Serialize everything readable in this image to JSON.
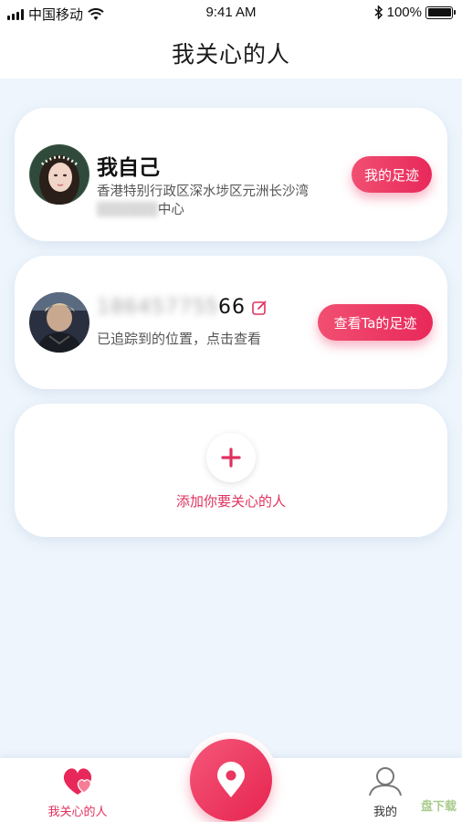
{
  "status_bar": {
    "carrier": "中国移动",
    "time": "9:41 AM",
    "battery": "100%",
    "battery_level": 1.0
  },
  "nav": {
    "title": "我关心的人"
  },
  "cards": {
    "self": {
      "name": "我自己",
      "address": "香港特别行政区深水埗区元洲长沙湾",
      "address_tail": "中心",
      "button": "我的足迹"
    },
    "tracked": {
      "phone_visible": "66",
      "status": "已追踪到的位置，点击查看",
      "button": "查看Ta的足迹"
    },
    "add": {
      "label": "添加你要关心的人"
    }
  },
  "tab_bar": {
    "left_label": "我关心的人",
    "right_label": "我的"
  },
  "watermark": "盘下载",
  "colors": {
    "accent": "#e8285a",
    "background": "#eef5fc"
  },
  "icons": [
    "signal-icon",
    "wifi-icon",
    "bluetooth-icon",
    "battery-icon",
    "edit-icon",
    "plus-icon",
    "location-pin-icon",
    "hearts-icon",
    "user-icon"
  ]
}
